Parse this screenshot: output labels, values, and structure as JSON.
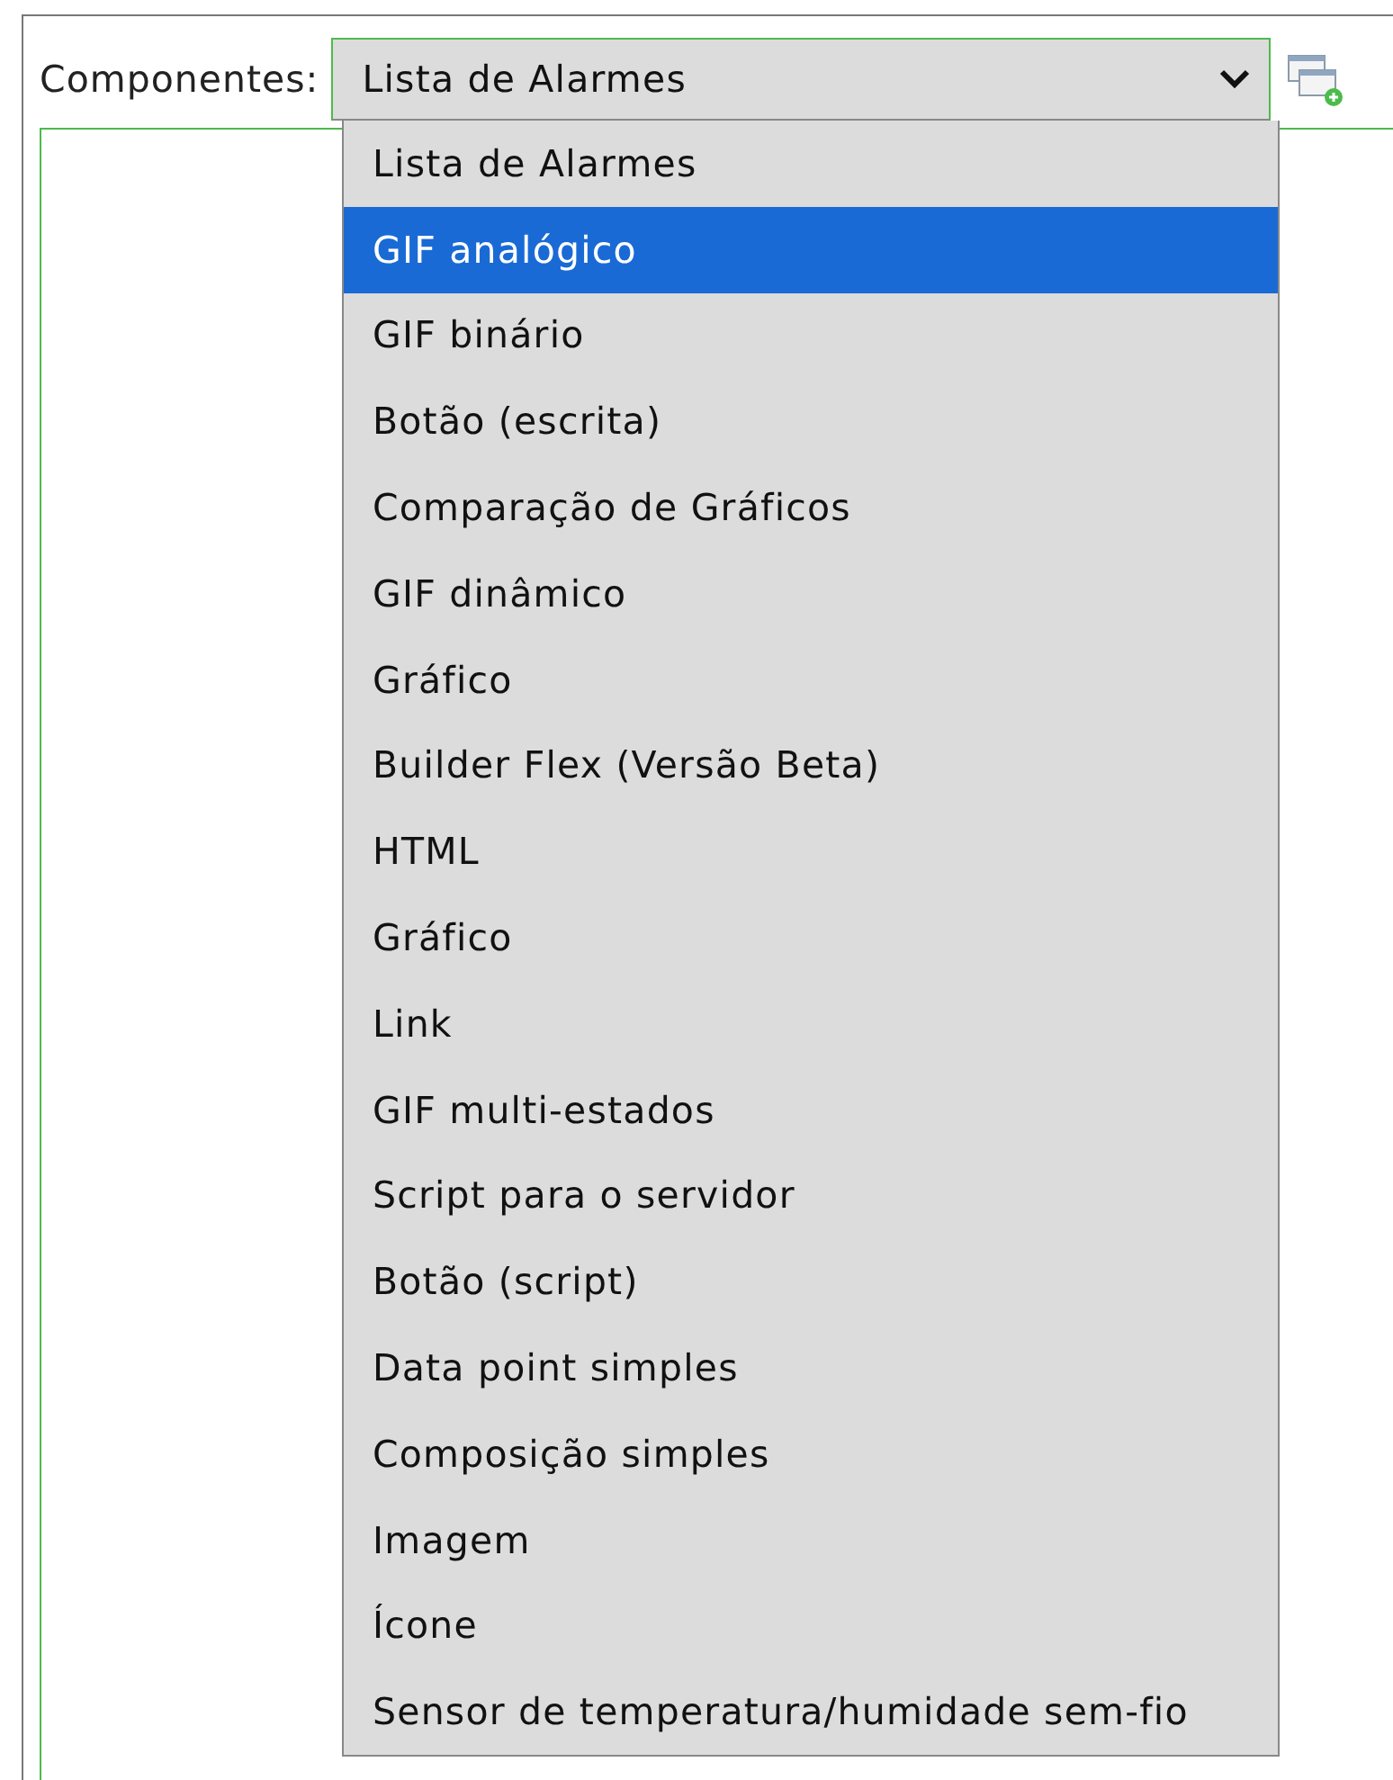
{
  "field": {
    "label": "Componentes:",
    "value": "Lista de Alarmes",
    "expanded": true
  },
  "options": [
    {
      "label": "Lista de Alarmes",
      "selected": false
    },
    {
      "label": "GIF analógico",
      "selected": true
    },
    {
      "label": "GIF binário",
      "selected": false
    },
    {
      "label": "Botão (escrita)",
      "selected": false
    },
    {
      "label": "Comparação de Gráficos",
      "selected": false
    },
    {
      "label": "GIF dinâmico",
      "selected": false
    },
    {
      "label": "Gráfico",
      "selected": false
    },
    {
      "label": "Builder Flex (Versão Beta)",
      "selected": false
    },
    {
      "label": "HTML",
      "selected": false
    },
    {
      "label": "Gráfico",
      "selected": false
    },
    {
      "label": "Link",
      "selected": false
    },
    {
      "label": "GIF multi-estados",
      "selected": false
    },
    {
      "label": "Script para o servidor",
      "selected": false
    },
    {
      "label": "Botão (script)",
      "selected": false
    },
    {
      "label": "Data point simples",
      "selected": false
    },
    {
      "label": "Composição simples",
      "selected": false
    },
    {
      "label": "Imagem",
      "selected": false
    },
    {
      "label": "Ícone",
      "selected": false
    },
    {
      "label": "Sensor de temperatura/humidade sem-fio",
      "selected": false
    }
  ]
}
